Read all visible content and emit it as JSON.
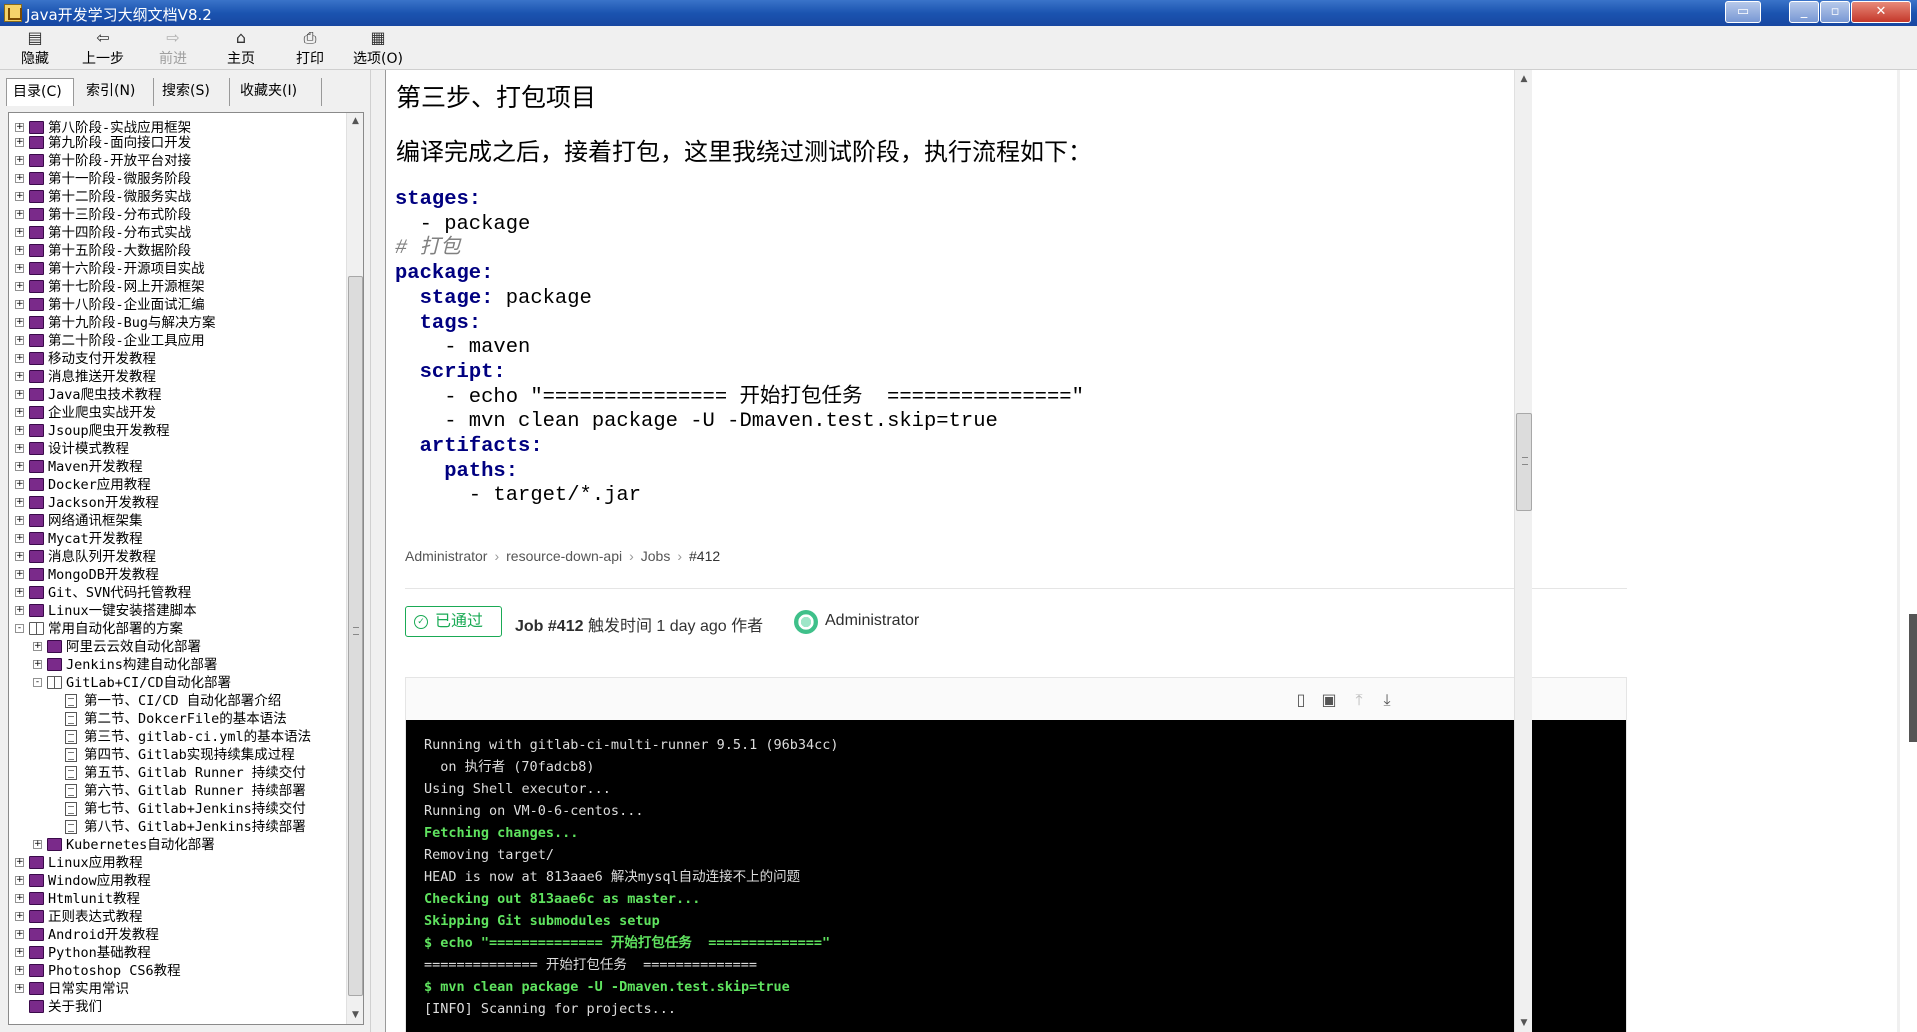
{
  "window": {
    "title": "Java开发学习大纲文档V8.2"
  },
  "toolbar": {
    "buttons": [
      {
        "label": "隐藏",
        "icon": "hide-icon"
      },
      {
        "label": "上一步",
        "icon": "back-arrow-icon"
      },
      {
        "label": "前进",
        "icon": "forward-arrow-icon",
        "disabled": true
      },
      {
        "label": "主页",
        "icon": "home-icon"
      },
      {
        "label": "打印",
        "icon": "printer-icon"
      },
      {
        "label": "选项(O)",
        "icon": "options-icon"
      }
    ]
  },
  "nav_tabs": [
    "目录(C)",
    "索引(N)",
    "搜索(S)",
    "收藏夹(I)"
  ],
  "tree": [
    {
      "label": "第八阶段-实战应用框架",
      "level": 0,
      "type": "book",
      "exp": "+"
    },
    {
      "label": "第九阶段-面向接口开发",
      "level": 0,
      "type": "book",
      "exp": "+"
    },
    {
      "label": "第十阶段-开放平台对接",
      "level": 0,
      "type": "book",
      "exp": "+"
    },
    {
      "label": "第十一阶段-微服务阶段",
      "level": 0,
      "type": "book",
      "exp": "+"
    },
    {
      "label": "第十二阶段-微服务实战",
      "level": 0,
      "type": "book",
      "exp": "+"
    },
    {
      "label": "第十三阶段-分布式阶段",
      "level": 0,
      "type": "book",
      "exp": "+"
    },
    {
      "label": "第十四阶段-分布式实战",
      "level": 0,
      "type": "book",
      "exp": "+"
    },
    {
      "label": "第十五阶段-大数据阶段",
      "level": 0,
      "type": "book",
      "exp": "+"
    },
    {
      "label": "第十六阶段-开源项目实战",
      "level": 0,
      "type": "book",
      "exp": "+"
    },
    {
      "label": "第十七阶段-网上开源框架",
      "level": 0,
      "type": "book",
      "exp": "+"
    },
    {
      "label": "第十八阶段-企业面试汇编",
      "level": 0,
      "type": "book",
      "exp": "+"
    },
    {
      "label": "第十九阶段-Bug与解决方案",
      "level": 0,
      "type": "book",
      "exp": "+"
    },
    {
      "label": "第二十阶段-企业工具应用",
      "level": 0,
      "type": "book",
      "exp": "+"
    },
    {
      "label": "移动支付开发教程",
      "level": 0,
      "type": "book",
      "exp": "+"
    },
    {
      "label": "消息推送开发教程",
      "level": 0,
      "type": "book",
      "exp": "+"
    },
    {
      "label": "Java爬虫技术教程",
      "level": 0,
      "type": "book",
      "exp": "+"
    },
    {
      "label": "企业爬虫实战开发",
      "level": 0,
      "type": "book",
      "exp": "+"
    },
    {
      "label": "Jsoup爬虫开发教程",
      "level": 0,
      "type": "book",
      "exp": "+"
    },
    {
      "label": "设计模式教程",
      "level": 0,
      "type": "book",
      "exp": "+"
    },
    {
      "label": "Maven开发教程",
      "level": 0,
      "type": "book",
      "exp": "+"
    },
    {
      "label": "Docker应用教程",
      "level": 0,
      "type": "book",
      "exp": "+"
    },
    {
      "label": "Jackson开发教程",
      "level": 0,
      "type": "book",
      "exp": "+"
    },
    {
      "label": "网络通讯框架集",
      "level": 0,
      "type": "book",
      "exp": "+"
    },
    {
      "label": "Mycat开发教程",
      "level": 0,
      "type": "book",
      "exp": "+"
    },
    {
      "label": "消息队列开发教程",
      "level": 0,
      "type": "book",
      "exp": "+"
    },
    {
      "label": "MongoDB开发教程",
      "level": 0,
      "type": "book",
      "exp": "+"
    },
    {
      "label": "Git、SVN代码托管教程",
      "level": 0,
      "type": "book",
      "exp": "+"
    },
    {
      "label": "Linux一键安装搭建脚本",
      "level": 0,
      "type": "book",
      "exp": "+"
    },
    {
      "label": "常用自动化部署的方案",
      "level": 0,
      "type": "open",
      "exp": "-"
    },
    {
      "label": "阿里云云效自动化部署",
      "level": 1,
      "type": "book",
      "exp": "+"
    },
    {
      "label": "Jenkins构建自动化部署",
      "level": 1,
      "type": "book",
      "exp": "+"
    },
    {
      "label": "GitLab+CI/CD自动化部署",
      "level": 1,
      "type": "open",
      "exp": "-"
    },
    {
      "label": "第一节、CI/CD 自动化部署介绍",
      "level": 2,
      "type": "page",
      "exp": ""
    },
    {
      "label": "第二节、DokcerFile的基本语法",
      "level": 2,
      "type": "page",
      "exp": ""
    },
    {
      "label": "第三节、gitlab-ci.yml的基本语法",
      "level": 2,
      "type": "page",
      "exp": ""
    },
    {
      "label": "第四节、Gitlab实现持续集成过程",
      "level": 2,
      "type": "page",
      "exp": ""
    },
    {
      "label": "第五节、Gitlab Runner 持续交付",
      "level": 2,
      "type": "page",
      "exp": ""
    },
    {
      "label": "第六节、Gitlab Runner 持续部署",
      "level": 2,
      "type": "page",
      "exp": ""
    },
    {
      "label": "第七节、Gitlab+Jenkins持续交付",
      "level": 2,
      "type": "page",
      "exp": ""
    },
    {
      "label": "第八节、Gitlab+Jenkins持续部署",
      "level": 2,
      "type": "page",
      "exp": ""
    },
    {
      "label": "Kubernetes自动化部署",
      "level": 1,
      "type": "book",
      "exp": "+"
    },
    {
      "label": "Linux应用教程",
      "level": 0,
      "type": "book",
      "exp": "+"
    },
    {
      "label": "Window应用教程",
      "level": 0,
      "type": "book",
      "exp": "+"
    },
    {
      "label": "Htmlunit教程",
      "level": 0,
      "type": "book",
      "exp": "+"
    },
    {
      "label": "正则表达式教程",
      "level": 0,
      "type": "book",
      "exp": "+"
    },
    {
      "label": "Android开发教程",
      "level": 0,
      "type": "book",
      "exp": "+"
    },
    {
      "label": "Python基础教程",
      "level": 0,
      "type": "book",
      "exp": "+"
    },
    {
      "label": "Photoshop CS6教程",
      "level": 0,
      "type": "book",
      "exp": "+"
    },
    {
      "label": "日常实用常识",
      "level": 0,
      "type": "book",
      "exp": "+"
    },
    {
      "label": "关于我们",
      "level": 0,
      "type": "book",
      "exp": ""
    }
  ],
  "article": {
    "heading": "第三步、打包项目",
    "intro": "编译完成之后，接着打包，这里我绕过测试阶段，执行流程如下：",
    "code_lines": [
      [
        {
          "t": "stages:",
          "k": "k"
        }
      ],
      [
        {
          "t": "  - package",
          "k": ""
        }
      ],
      [
        {
          "t": "# 打包",
          "k": "c"
        }
      ],
      [
        {
          "t": "package:",
          "k": "k"
        }
      ],
      [
        {
          "t": "  ",
          "k": ""
        },
        {
          "t": "stage:",
          "k": "k"
        },
        {
          "t": " package",
          "k": ""
        }
      ],
      [
        {
          "t": "  ",
          "k": ""
        },
        {
          "t": "tags:",
          "k": "k"
        }
      ],
      [
        {
          "t": "    - maven",
          "k": ""
        }
      ],
      [
        {
          "t": "  ",
          "k": ""
        },
        {
          "t": "script:",
          "k": "k"
        }
      ],
      [
        {
          "t": "    - echo \"=============== 开始打包任务  ===============\"",
          "k": ""
        }
      ],
      [
        {
          "t": "    - mvn clean package -U -Dmaven.test.skip=true",
          "k": ""
        }
      ],
      [
        {
          "t": "  ",
          "k": ""
        },
        {
          "t": "artifacts:",
          "k": "k"
        }
      ],
      [
        {
          "t": "    ",
          "k": ""
        },
        {
          "t": "paths:",
          "k": "k"
        }
      ],
      [
        {
          "t": "      - target/*.jar",
          "k": ""
        }
      ]
    ]
  },
  "gitlab": {
    "breadcrumb": [
      "Administrator",
      "resource-down-api",
      "Jobs",
      "#412"
    ],
    "status_badge": "已通过",
    "job_id": "Job #412",
    "job_meta": "触发时间 1 day ago 作者",
    "author": "Administrator",
    "colors": {
      "success": "#1aaa55",
      "terminal_green": "#5fe35f"
    },
    "terminal_lines": [
      {
        "t": "Running with gitlab-ci-multi-runner 9.5.1 (96b34cc)",
        "g": false
      },
      {
        "t": "  on 执行者 (70fadcb8)",
        "g": false
      },
      {
        "t": "Using Shell executor...",
        "g": false
      },
      {
        "t": "Running on VM-0-6-centos...",
        "g": false
      },
      {
        "t": "Fetching changes...",
        "g": true
      },
      {
        "t": "Removing target/",
        "g": false
      },
      {
        "t": "HEAD is now at 813aae6 解决mysql自动连接不上的问题",
        "g": false
      },
      {
        "t": "Checking out 813aae6c as master...",
        "g": true
      },
      {
        "t": "Skipping Git submodules setup",
        "g": true
      },
      {
        "t": "$ echo \"============== 开始打包任务  ==============\"",
        "g": true
      },
      {
        "t": "============== 开始打包任务  ==============",
        "g": false
      },
      {
        "t": "$ mvn clean package -U -Dmaven.test.skip=true",
        "g": true
      },
      {
        "t": "[INFO] Scanning for projects...",
        "g": false
      }
    ]
  }
}
